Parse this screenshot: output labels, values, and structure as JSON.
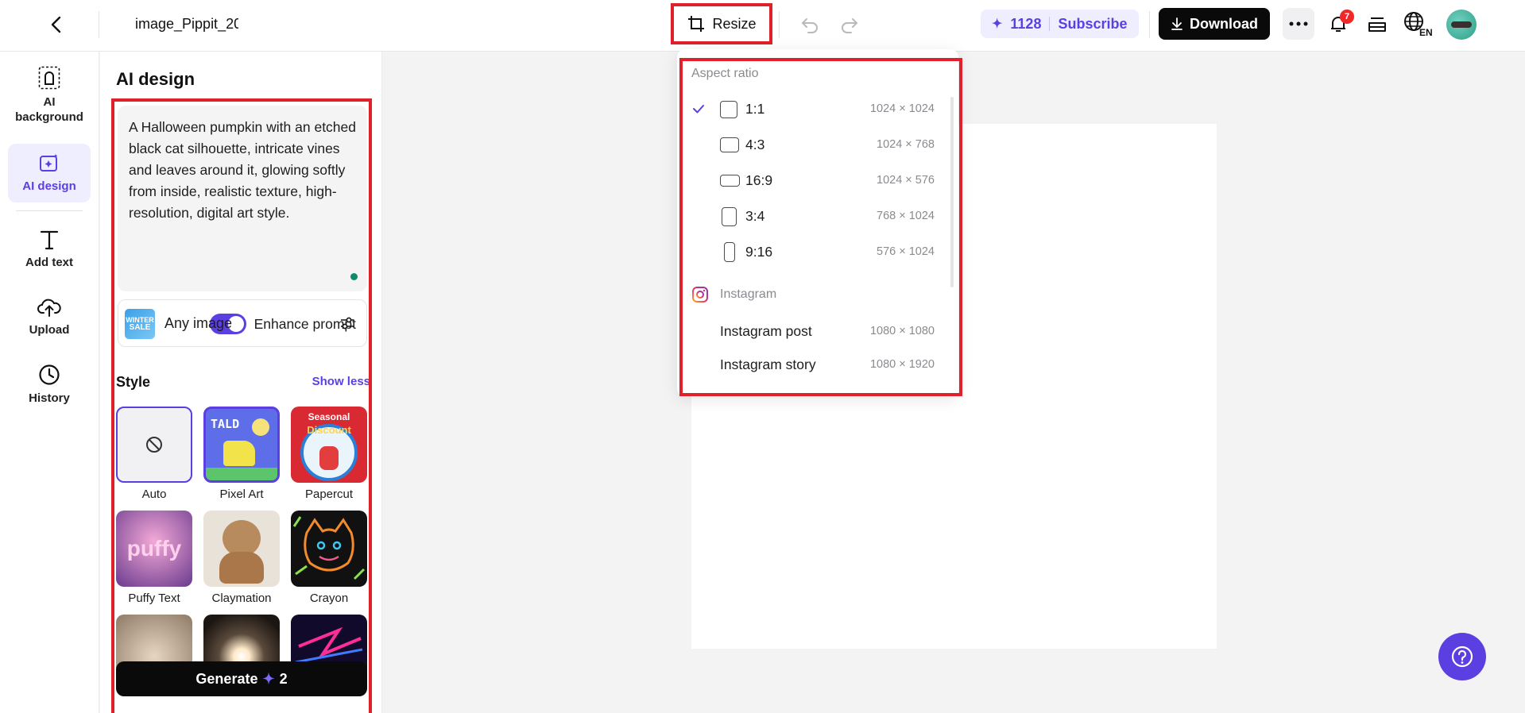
{
  "header": {
    "file_title": "image_Pippit_20",
    "resize_label": "Resize",
    "credits": "1128",
    "subscribe_label": "Subscribe",
    "download_label": "Download",
    "notification_count": "7",
    "language_code": "EN"
  },
  "rail": {
    "items": [
      {
        "label": "AI background",
        "icon": "ai-background-icon"
      },
      {
        "label": "AI design",
        "icon": "ai-design-icon",
        "active": true
      },
      {
        "label": "Add text",
        "icon": "text-icon"
      },
      {
        "label": "Upload",
        "icon": "upload-cloud-icon"
      },
      {
        "label": "History",
        "icon": "clock-icon"
      }
    ]
  },
  "panel": {
    "title": "AI design",
    "prompt": "A Halloween pumpkin with an etched black cat silhouette, intricate vines and leaves around it, glowing softly from inside, realistic texture, high-resolution, digital art style.",
    "enhance_label": "Enhance prompt",
    "enhance_enabled": true,
    "image_type_label": "Any image",
    "image_type_thumb_text": [
      "WINTER",
      "SALE"
    ],
    "style_heading": "Style",
    "show_less_label": "Show less",
    "styles": [
      {
        "label": "Auto",
        "selected": true
      },
      {
        "label": "Pixel Art"
      },
      {
        "label": "Papercut"
      },
      {
        "label": "Puffy Text"
      },
      {
        "label": "Claymation"
      },
      {
        "label": "Crayon"
      },
      {
        "label": ""
      },
      {
        "label": ""
      },
      {
        "label": ""
      }
    ],
    "style_thumb_texts": {
      "pixel": "TALD",
      "papercut_top": "Seasonal",
      "papercut_bottom": "Discount",
      "puffy": "puffy"
    },
    "generate_label": "Generate",
    "generate_cost": "2"
  },
  "resize_menu": {
    "aspect_heading": "Aspect ratio",
    "ratios": [
      {
        "label": "1:1",
        "dims": "1024 × 1024",
        "checked": true
      },
      {
        "label": "4:3",
        "dims": "1024 × 768"
      },
      {
        "label": "16:9",
        "dims": "1024 × 576"
      },
      {
        "label": "3:4",
        "dims": "768 × 1024"
      },
      {
        "label": "9:16",
        "dims": "576 × 1024"
      }
    ],
    "instagram_heading": "Instagram",
    "instagram": [
      {
        "label": "Instagram post",
        "dims": "1080 × 1080"
      },
      {
        "label": "Instagram story",
        "dims": "1080 × 1920"
      }
    ]
  },
  "colors": {
    "accent": "#5b3fe0",
    "highlight_frame": "#e0202a",
    "download_bg": "#0a0a0a"
  }
}
